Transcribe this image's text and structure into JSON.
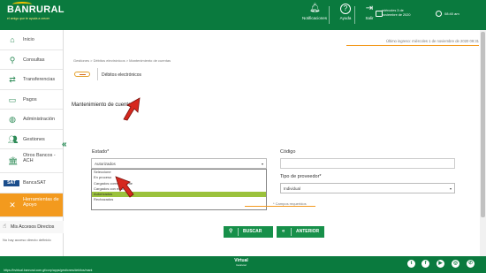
{
  "header": {
    "brand": "BANRURAL",
    "tagline": "el amigo que te ayuda a crecer",
    "notifications_label": "Notificaciones",
    "help_label": "Ayuda",
    "exit_label": "Salir",
    "date_line1": "miércoles 3 de",
    "date_line2": "noviembre de 2020",
    "time": "08:40 am"
  },
  "sidebar": {
    "items": [
      {
        "label": "Inicio",
        "icon": "home-icon"
      },
      {
        "label": "Consultas",
        "icon": "search-icon"
      },
      {
        "label": "Transferencias",
        "icon": "transfer-icon"
      },
      {
        "label": "Pagos",
        "icon": "payment-icon"
      },
      {
        "label": "Administración",
        "icon": "globe-icon"
      },
      {
        "label": "Gestiones",
        "icon": "people-icon"
      },
      {
        "label": "Otros Bancos - ACH",
        "icon": "bank-icon"
      },
      {
        "label": "BancaSAT",
        "icon": "sat-icon"
      },
      {
        "label": "Herramientas de Apoyo",
        "icon": "tools-icon"
      }
    ],
    "my_access_label": "Mis Accesos Directos",
    "no_access_text": "No hay acceso directo definido",
    "active_color": "#f39a1e"
  },
  "main": {
    "last_login": "Último ingreso: miércoles 1 de noviembre de 2020 09:31",
    "breadcrumb": "Gestiones > Débitos electrónicos > Mantenimiento de cuentas",
    "page_title": "Débitos electrónicos",
    "section_title": "Mantenimiento de cuentas",
    "estado_label": "Estado*",
    "estado_value": "Autorizados",
    "estado_options": [
      "Seleccione",
      "En proceso",
      "Cargados correctamente",
      "Cargados con error",
      "Autorizados",
      "Rechazados"
    ],
    "estado_selected_index": 4,
    "codigo_label": "Código",
    "tipo_label": "Tipo de proveedor*",
    "tipo_value": "Individual",
    "required_text": "* Campos requeridos",
    "search_button": "BUSCAR",
    "back_button": "ANTERIOR"
  },
  "footer": {
    "url": "https://bvirtual.banrural.com.gt/corp/apps/gestiones/debitos/mant",
    "brand": "Virtual",
    "brand_sub": "banrural"
  },
  "colors": {
    "primary_green": "#0a7a3e",
    "button_green": "#17904a",
    "highlight": "#9bc23c",
    "accent_orange": "#f39a1e",
    "arrow_red": "#d6281e"
  }
}
